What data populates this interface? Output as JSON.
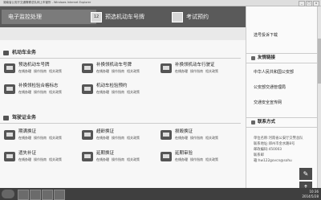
{
  "browser": {
    "title": "湖南省公安厅交通警察总队网上车管所 - Windows Internet Explorer",
    "controls": [
      "_",
      "□",
      "x"
    ]
  },
  "nav": {
    "items": [
      {
        "label": "电子监控处理",
        "icon": "camera-icon"
      },
      {
        "label": "预选机动车号牌",
        "icon_text": "12"
      },
      {
        "label": "考试预约",
        "icon": "calendar-icon"
      }
    ]
  },
  "sections": {
    "vehicle": {
      "title": "机动车业务",
      "items": [
        {
          "name": "预选机动车号牌",
          "links": [
            "在线办理",
            "操作指南",
            "相关政策"
          ]
        },
        {
          "name": "补换领机动车号牌",
          "icon_text": "12",
          "links": [
            "在线办理",
            "操作指南",
            "相关政策"
          ]
        },
        {
          "name": "补换领机动车行驶证",
          "links": [
            "在线办理",
            "操作指南",
            "相关政策"
          ]
        },
        {
          "name": "补换领检验合格标志",
          "links": [
            "在线办理",
            "操作指南",
            "相关政策"
          ]
        },
        {
          "name": "机动车检验预约",
          "links": [
            "在线办理",
            "操作指南",
            "相关政策"
          ]
        }
      ]
    },
    "license": {
      "title": "驾驶证业务",
      "items": [
        {
          "name": "期满换证",
          "links": [
            "在线办理",
            "操作指南",
            "相关政策"
          ]
        },
        {
          "name": "超龄换证",
          "links": [
            "在线办理",
            "操作指南",
            "相关政策"
          ]
        },
        {
          "name": "损毁换证",
          "links": [
            "在线办理",
            "操作指南",
            "相关政策"
          ]
        },
        {
          "name": "遗失补证",
          "links": [
            "在线办理",
            "操作指南",
            "相关政策"
          ]
        },
        {
          "name": "延期换证",
          "links": [
            "在线办理",
            "操作指南",
            "相关政策"
          ]
        },
        {
          "name": "延期审验",
          "links": [
            "在线办理",
            "操作指南",
            "相关政策"
          ]
        }
      ]
    }
  },
  "sidebar": {
    "top_item": "选号投诉下载",
    "links_title": "友情链接",
    "links": [
      "中华人民共和国公安部",
      "公安部交通管理局",
      "交通安全宣传网"
    ],
    "contact_title": "联系方式",
    "contact_lines": [
      "单位名称:河南省公安厅交警总队",
      "联系地址:郑州市金水路8号",
      "邮政编码:450003",
      "联系邮",
      "箱:hw122govcn@sohu"
    ]
  },
  "fabs": {
    "share": "✎",
    "top": "↑"
  },
  "taskbar": {
    "time": "10:36",
    "date": "2014/5/28"
  }
}
